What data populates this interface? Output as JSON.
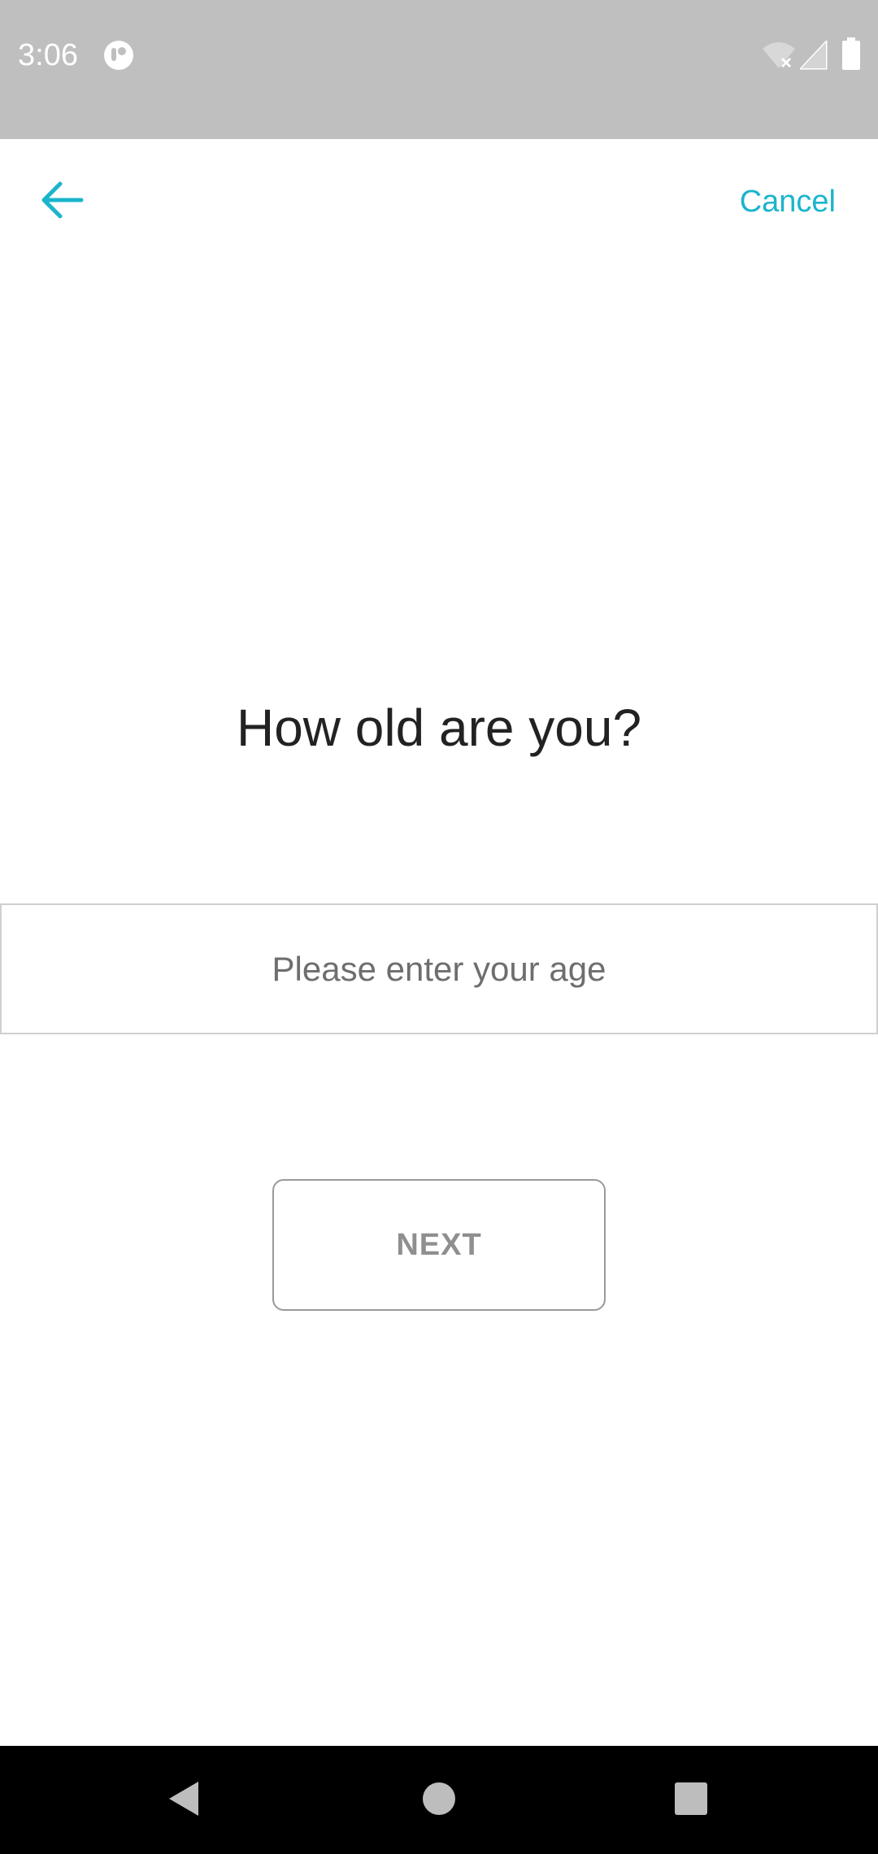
{
  "status_bar": {
    "time": "3:06",
    "app_icon": "circle-app-icon",
    "wifi_icon": "wifi-off-icon",
    "signal_icon": "cell-signal-icon",
    "battery_icon": "battery-icon"
  },
  "toolbar": {
    "back_icon": "arrow-left-icon",
    "cancel_label": "Cancel"
  },
  "question": {
    "title": "How old are you?"
  },
  "age_input": {
    "value": "",
    "placeholder": "Please enter your age"
  },
  "next_button": {
    "label": "NEXT"
  },
  "nav_bar": {
    "back_icon": "triangle-back-icon",
    "home_icon": "circle-home-icon",
    "recents_icon": "square-recents-icon"
  },
  "colors": {
    "accent": "#1ab5cc",
    "status_bar": "#bfbfbf",
    "text_primary": "#222222",
    "button_text": "#8f8f8f",
    "nav_bar": "#000000"
  }
}
